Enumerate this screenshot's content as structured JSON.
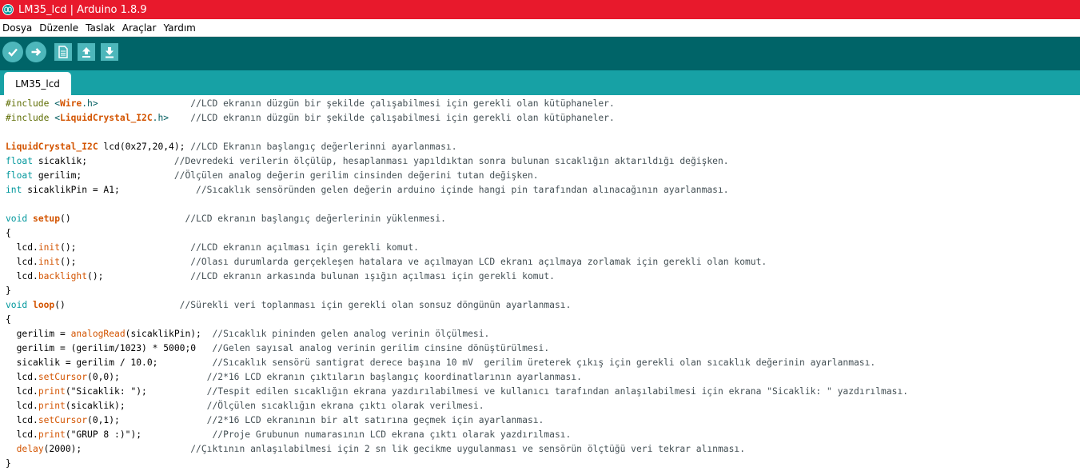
{
  "window": {
    "title": "LM35_lcd | Arduino 1.8.9"
  },
  "menu": [
    "Dosya",
    "Düzenle",
    "Taslak",
    "Araçlar",
    "Yardım"
  ],
  "toolbar": {
    "buttons": [
      "verify-icon",
      "upload-icon",
      "new-icon",
      "open-icon",
      "save-icon"
    ]
  },
  "tabs": [
    {
      "label": "LM35_lcd",
      "active": true
    }
  ],
  "editor": {
    "lines": [
      [
        {
          "t": "#include ",
          "c": "pp"
        },
        {
          "t": "<",
          "c": "str"
        },
        {
          "t": "Wire",
          "c": "lib"
        },
        {
          "t": ".h>",
          "c": "str"
        },
        {
          "t": "                 //LCD ekranın düzgün bir şekilde çalışabilmesi için gerekli olan kütüphaneler.",
          "c": "cm"
        }
      ],
      [
        {
          "t": "#include ",
          "c": "pp"
        },
        {
          "t": "<",
          "c": "str"
        },
        {
          "t": "LiquidCrystal_I2C",
          "c": "lib"
        },
        {
          "t": ".h>",
          "c": "str"
        },
        {
          "t": "    //LCD ekranın düzgün bir şekilde çalışabilmesi için gerekli olan kütüphaneler.",
          "c": "cm"
        }
      ],
      [],
      [
        {
          "t": "LiquidCrystal_I2C",
          "c": "lib"
        },
        {
          "t": " lcd(0x27,20,4); ",
          "c": "tx"
        },
        {
          "t": "//LCD Ekranın başlangıç değerlerinni ayarlanması.",
          "c": "cm"
        }
      ],
      [
        {
          "t": "float",
          "c": "kw"
        },
        {
          "t": " sicaklik;",
          "c": "tx"
        },
        {
          "t": "                //Devredeki verilerin ölçülüp, hesaplanması yapıldıktan sonra bulunan sıcaklığın aktarıldığı değişken.",
          "c": "cm"
        }
      ],
      [
        {
          "t": "float",
          "c": "kw"
        },
        {
          "t": " gerilim;",
          "c": "tx"
        },
        {
          "t": "                 //Ölçülen analog değerin gerilim cinsinden değerini tutan değişken.",
          "c": "cm"
        }
      ],
      [
        {
          "t": "int",
          "c": "kw"
        },
        {
          "t": " sicaklikPin = A1;",
          "c": "tx"
        },
        {
          "t": "              //Sıcaklık sensöründen gelen değerin arduino içinde hangi pin tarafından alınacağının ayarlanması.",
          "c": "cm"
        }
      ],
      [],
      [
        {
          "t": "void",
          "c": "kw"
        },
        {
          "t": " ",
          "c": "tx"
        },
        {
          "t": "setup",
          "c": "lib"
        },
        {
          "t": "()",
          "c": "tx"
        },
        {
          "t": "                     //LCD ekranın başlangıç değerlerinin yüklenmesi.",
          "c": "cm"
        }
      ],
      [
        {
          "t": "{",
          "c": "tx"
        }
      ],
      [
        {
          "t": "  lcd.",
          "c": "tx"
        },
        {
          "t": "init",
          "c": "fn"
        },
        {
          "t": "();",
          "c": "tx"
        },
        {
          "t": "                     //LCD ekranın açılması için gerekli komut.",
          "c": "cm"
        }
      ],
      [
        {
          "t": "  lcd.",
          "c": "tx"
        },
        {
          "t": "init",
          "c": "fn"
        },
        {
          "t": "();",
          "c": "tx"
        },
        {
          "t": "                     //Olası durumlarda gerçekleşen hatalara ve açılmayan LCD ekranı açılmaya zorlamak için gerekli olan komut.",
          "c": "cm"
        }
      ],
      [
        {
          "t": "  lcd.",
          "c": "tx"
        },
        {
          "t": "backlight",
          "c": "fn"
        },
        {
          "t": "();",
          "c": "tx"
        },
        {
          "t": "                //LCD ekranın arkasında bulunan ışığın açılması için gerekli komut.",
          "c": "cm"
        }
      ],
      [
        {
          "t": "}",
          "c": "tx"
        }
      ],
      [
        {
          "t": "void",
          "c": "kw"
        },
        {
          "t": " ",
          "c": "tx"
        },
        {
          "t": "loop",
          "c": "lib"
        },
        {
          "t": "()",
          "c": "tx"
        },
        {
          "t": "                     //Sürekli veri toplanması için gerekli olan sonsuz döngünün ayarlanması.",
          "c": "cm"
        }
      ],
      [
        {
          "t": "{",
          "c": "tx"
        }
      ],
      [
        {
          "t": "  gerilim = ",
          "c": "tx"
        },
        {
          "t": "analogRead",
          "c": "fn"
        },
        {
          "t": "(sicaklikPin);",
          "c": "tx"
        },
        {
          "t": "  //Sıcaklık pininden gelen analog verinin ölçülmesi.",
          "c": "cm"
        }
      ],
      [
        {
          "t": "  gerilim = (gerilim/1023) * 5000;0",
          "c": "tx"
        },
        {
          "t": "   //Gelen sayısal analog verinin gerilim cinsine dönüştürülmesi.",
          "c": "cm"
        }
      ],
      [
        {
          "t": "  sicaklik = gerilim / 10.0;",
          "c": "tx"
        },
        {
          "t": "          //Sıcaklık sensörü santigrat derece başına 10 mV  gerilim üreterek çıkış için gerekli olan sıcaklık değerinin ayarlanması.",
          "c": "cm"
        }
      ],
      [
        {
          "t": "  lcd.",
          "c": "tx"
        },
        {
          "t": "setCursor",
          "c": "fn"
        },
        {
          "t": "(0,0);",
          "c": "tx"
        },
        {
          "t": "                //2*16 LCD ekranın çıktıların başlangıç koordinatlarının ayarlanması.",
          "c": "cm"
        }
      ],
      [
        {
          "t": "  lcd.",
          "c": "tx"
        },
        {
          "t": "print",
          "c": "fn"
        },
        {
          "t": "(\"Sicaklik: \");",
          "c": "tx"
        },
        {
          "t": "           //Tespit edilen sıcaklığın ekrana yazdırılabilmesi ve kullanıcı tarafından anlaşılabilmesi için ekrana \"Sicaklik: \" yazdırılması.",
          "c": "cm"
        }
      ],
      [
        {
          "t": "  lcd.",
          "c": "tx"
        },
        {
          "t": "print",
          "c": "fn"
        },
        {
          "t": "(sicaklik);",
          "c": "tx"
        },
        {
          "t": "               //Ölçülen sıcaklığın ekrana çıktı olarak verilmesi.",
          "c": "cm"
        }
      ],
      [
        {
          "t": "  lcd.",
          "c": "tx"
        },
        {
          "t": "setCursor",
          "c": "fn"
        },
        {
          "t": "(0,1);",
          "c": "tx"
        },
        {
          "t": "                //2*16 LCD ekranının bir alt satırına geçmek için ayarlanması.",
          "c": "cm"
        }
      ],
      [
        {
          "t": "  lcd.",
          "c": "tx"
        },
        {
          "t": "print",
          "c": "fn"
        },
        {
          "t": "(\"GRUP 8 :)\");",
          "c": "tx"
        },
        {
          "t": "             //Proje Grubunun numarasının LCD ekrana çıktı olarak yazdırılması.",
          "c": "cm"
        }
      ],
      [
        {
          "t": "  ",
          "c": "tx"
        },
        {
          "t": "delay",
          "c": "fn"
        },
        {
          "t": "(2000);",
          "c": "tx"
        },
        {
          "t": "                    //Çıktının anlaşılabilmesi için 2 sn lik gecikme uygulanması ve sensörün ölçtüğü veri tekrar alınması.",
          "c": "cm"
        }
      ],
      [
        {
          "t": "}",
          "c": "tx"
        }
      ]
    ]
  },
  "colors": {
    "titlebar": "#e8192c",
    "toolbar": "#006468",
    "tabbar": "#17a1a5",
    "keyword": "#00979c",
    "function": "#d35400"
  }
}
